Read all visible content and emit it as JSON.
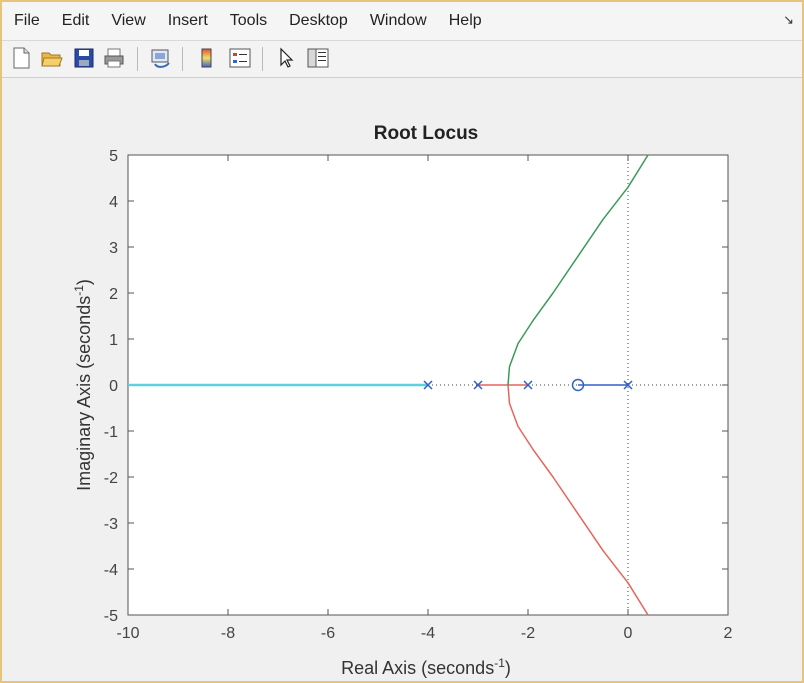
{
  "menu": {
    "items": [
      "File",
      "Edit",
      "View",
      "Insert",
      "Tools",
      "Desktop",
      "Window",
      "Help"
    ],
    "dock_arrow": "↘"
  },
  "toolbar": {
    "buttons": [
      "new-figure-icon",
      "open-file-icon",
      "save-icon",
      "print-icon",
      "link-plot-icon",
      "colorbar-icon",
      "legend-icon",
      "pointer-icon",
      "plot-browser-icon"
    ]
  },
  "chart_data": {
    "type": "line",
    "title": "Root Locus",
    "xlabel": "Real Axis (seconds",
    "xlabel_sup": "-1",
    "xlabel_end": ")",
    "ylabel": "Imaginary Axis (seconds",
    "ylabel_sup": "-1",
    "ylabel_end": ")",
    "xlim": [
      -10,
      2
    ],
    "ylim": [
      -5,
      5
    ],
    "xticks": [
      "-10",
      "-8",
      "-6",
      "-4",
      "-2",
      "0",
      "2"
    ],
    "xtick_values": [
      -10,
      -8,
      -6,
      -4,
      -2,
      0,
      2
    ],
    "yticks": [
      "5",
      "4",
      "3",
      "2",
      "1",
      "0",
      "-1",
      "-2",
      "-3",
      "-4",
      "-5"
    ],
    "ytick_values": [
      5,
      4,
      3,
      2,
      1,
      0,
      -1,
      -2,
      -3,
      -4,
      -5
    ],
    "grid": false,
    "poles": [
      [
        -4,
        0
      ],
      [
        -3,
        0
      ],
      [
        -2,
        0
      ],
      [
        0,
        0
      ]
    ],
    "zeros": [
      [
        -1,
        0
      ]
    ],
    "series": [
      {
        "color": "#5fd0e0",
        "points": [
          [
            -4,
            0
          ],
          [
            -10,
            0
          ]
        ]
      },
      {
        "color": "#e8645a",
        "points": [
          [
            -3,
            0
          ],
          [
            -2.4,
            0
          ],
          [
            -2.37,
            -0.4
          ],
          [
            -2.2,
            -0.9
          ],
          [
            -1.9,
            -1.4
          ],
          [
            -1.5,
            -2.0
          ],
          [
            -1.0,
            -2.8
          ],
          [
            -0.5,
            -3.6
          ],
          [
            0.0,
            -4.3
          ],
          [
            0.4,
            -5.0
          ]
        ]
      },
      {
        "color": "#e8645a",
        "points": [
          [
            -2,
            0
          ],
          [
            -2.4,
            0
          ]
        ]
      },
      {
        "color": "#3a9a5a",
        "points": [
          [
            -2.4,
            0
          ],
          [
            -2.37,
            0.4
          ],
          [
            -2.2,
            0.9
          ],
          [
            -1.9,
            1.4
          ],
          [
            -1.5,
            2.0
          ],
          [
            -1.0,
            2.8
          ],
          [
            -0.5,
            3.6
          ],
          [
            0.0,
            4.3
          ],
          [
            0.4,
            5.0
          ]
        ]
      },
      {
        "color": "#3060c8",
        "points": [
          [
            0,
            0
          ],
          [
            -1,
            0
          ]
        ]
      }
    ],
    "asymptote_color": "#444444"
  }
}
